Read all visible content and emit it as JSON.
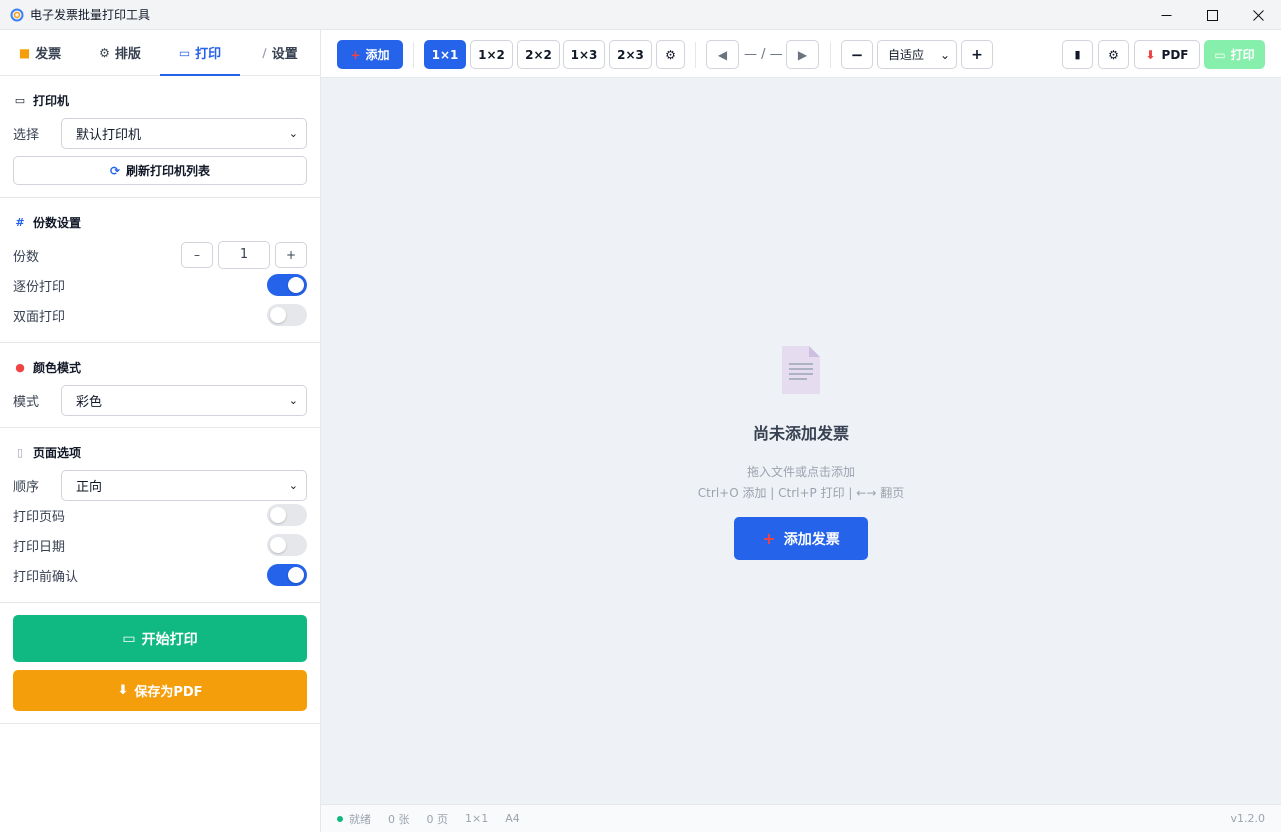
{
  "window": {
    "title": "电子发票批量打印工具",
    "minimize": "—",
    "maximize": "☐",
    "close": "✕"
  },
  "sidebar": {
    "tabs": [
      {
        "label": "发票",
        "icon": "folder-icon"
      },
      {
        "label": "排版",
        "icon": "gear-icon"
      },
      {
        "label": "打印",
        "icon": "printer-icon"
      },
      {
        "label": "设置",
        "icon": "wrench-icon"
      }
    ],
    "printer": {
      "title": "打印机",
      "select_label": "选择",
      "select_value": "默认打印机",
      "refresh_label": "刷新打印机列表"
    },
    "copies": {
      "title": "份数设置",
      "count_label": "份数",
      "minus": "–",
      "value": "1",
      "plus": "+",
      "collate_label": "逐份打印",
      "duplex_label": "双面打印"
    },
    "color": {
      "title": "颜色模式",
      "mode_label": "模式",
      "mode_value": "彩色"
    },
    "page": {
      "title": "页面选项",
      "order_label": "顺序",
      "order_value": "正向",
      "page_number_label": "打印页码",
      "date_label": "打印日期",
      "confirm_label": "打印前确认"
    },
    "start_print_label": "开始打印",
    "save_pdf_label": "保存为PDF"
  },
  "toolbar": {
    "add_label": "添加",
    "layouts": [
      "1×1",
      "1×2",
      "2×2",
      "1×3",
      "2×3"
    ],
    "page_indicator": "— / —",
    "zoom_value": "自适应",
    "pdf_label": "PDF",
    "print_label": "打印"
  },
  "main": {
    "empty_title": "尚未添加发票",
    "empty_hint": "拖入文件或点击添加",
    "shortcuts": "Ctrl+O 添加 | Ctrl+P 打印 | ←→ 翻页",
    "add_invoice_label": "添加发票"
  },
  "status": {
    "state": "就绪",
    "count": "0 张",
    "pages": "0 页",
    "layout": "1×1",
    "paper": "A4",
    "version": "v1.2.0"
  },
  "colors": {
    "accent": "#2563eb",
    "success": "#10b981",
    "warning": "#f59e0b"
  }
}
